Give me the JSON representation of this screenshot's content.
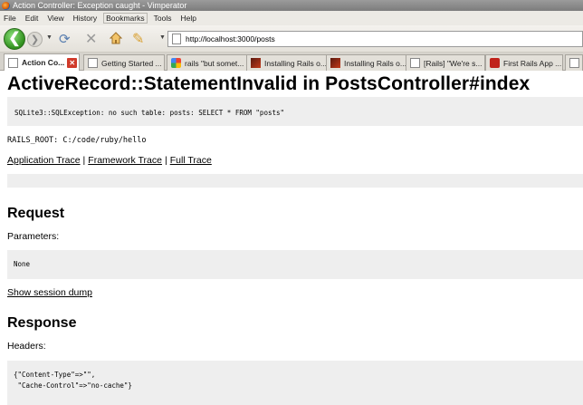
{
  "window": {
    "title": "Action Controller: Exception caught - Vimperator"
  },
  "menu": [
    "File",
    "Edit",
    "View",
    "History",
    "Bookmarks",
    "Tools",
    "Help"
  ],
  "nav": {
    "url": "http://localhost:3000/posts"
  },
  "tabs": [
    {
      "label": "Action Co...",
      "icon": "page-icon"
    },
    {
      "label": "Getting Started ...",
      "icon": "page-icon"
    },
    {
      "label": "rails \"but somet...",
      "icon": "google-icon"
    },
    {
      "label": "Installing Rails o...",
      "icon": "dark-site-icon"
    },
    {
      "label": "Installing Rails o...",
      "icon": "dark-site-icon"
    },
    {
      "label": "[Rails] \"We're s...",
      "icon": "page-icon"
    },
    {
      "label": "First Rails App ...",
      "icon": "red-site-icon"
    }
  ],
  "page": {
    "title": "ActiveRecord::StatementInvalid in PostsController#index",
    "error_message": "SQLite3::SQLException: no such table: posts: SELECT * FROM \"posts\"",
    "rails_root": "RAILS_ROOT: C:/code/ruby/hello",
    "trace_links": [
      "Application Trace",
      "Framework Trace",
      "Full Trace"
    ],
    "trace_separator": "|",
    "request_heading": "Request",
    "parameters_label": "Parameters:",
    "parameters_value": "None",
    "session_link": "Show session dump",
    "response_heading": "Response",
    "headers_label": "Headers:",
    "headers_lines": [
      "{\"Content-Type\"=>\"\",",
      " \"Cache-Control\"=>\"no-cache\"}"
    ]
  },
  "colors": {
    "accent_green": "#2f8f1c",
    "close_red": "#d03a2a",
    "code_bg": "#eeeeee"
  }
}
